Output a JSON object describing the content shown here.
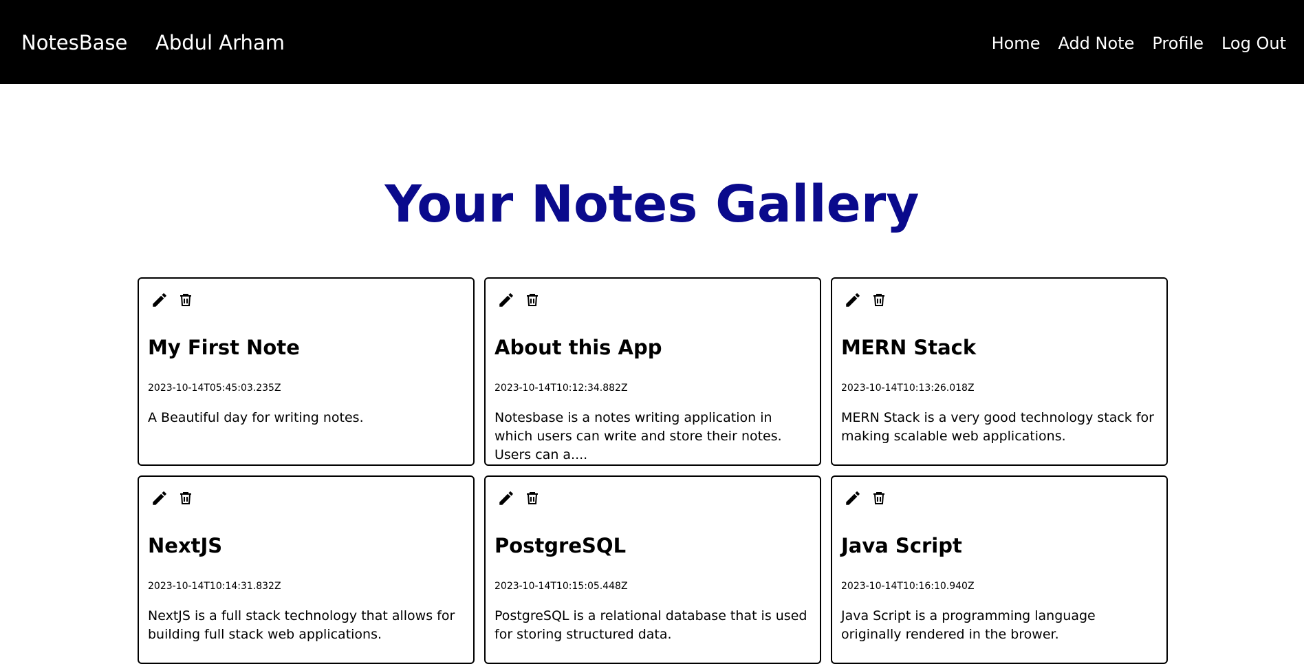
{
  "navbar": {
    "brand": "NotesBase",
    "username": "Abdul Arham",
    "links": [
      "Home",
      "Add Note",
      "Profile",
      "Log Out"
    ]
  },
  "page": {
    "title": "Your Notes Gallery"
  },
  "colors": {
    "navbar_bg": "#000000",
    "title": "#0a0a8c",
    "card_border": "#000000"
  },
  "notes": [
    {
      "title": "My First Note",
      "date": "2023-10-14T05:45:03.235Z",
      "description": "A Beautiful day for writing notes."
    },
    {
      "title": "About this App",
      "date": "2023-10-14T10:12:34.882Z",
      "description": "Notesbase is a notes writing application in which users can write and store their notes. Users can a...."
    },
    {
      "title": "MERN Stack",
      "date": "2023-10-14T10:13:26.018Z",
      "description": "MERN Stack is a very good technology stack for making scalable web applications."
    },
    {
      "title": "NextJS",
      "date": "2023-10-14T10:14:31.832Z",
      "description": "NextJS is a full stack technology that allows for building full stack web applications."
    },
    {
      "title": "PostgreSQL",
      "date": "2023-10-14T10:15:05.448Z",
      "description": "PostgreSQL is a relational database that is used for storing structured data."
    },
    {
      "title": "Java Script",
      "date": "2023-10-14T10:16:10.940Z",
      "description": "Java Script is a programming language originally rendered in the brower."
    }
  ]
}
